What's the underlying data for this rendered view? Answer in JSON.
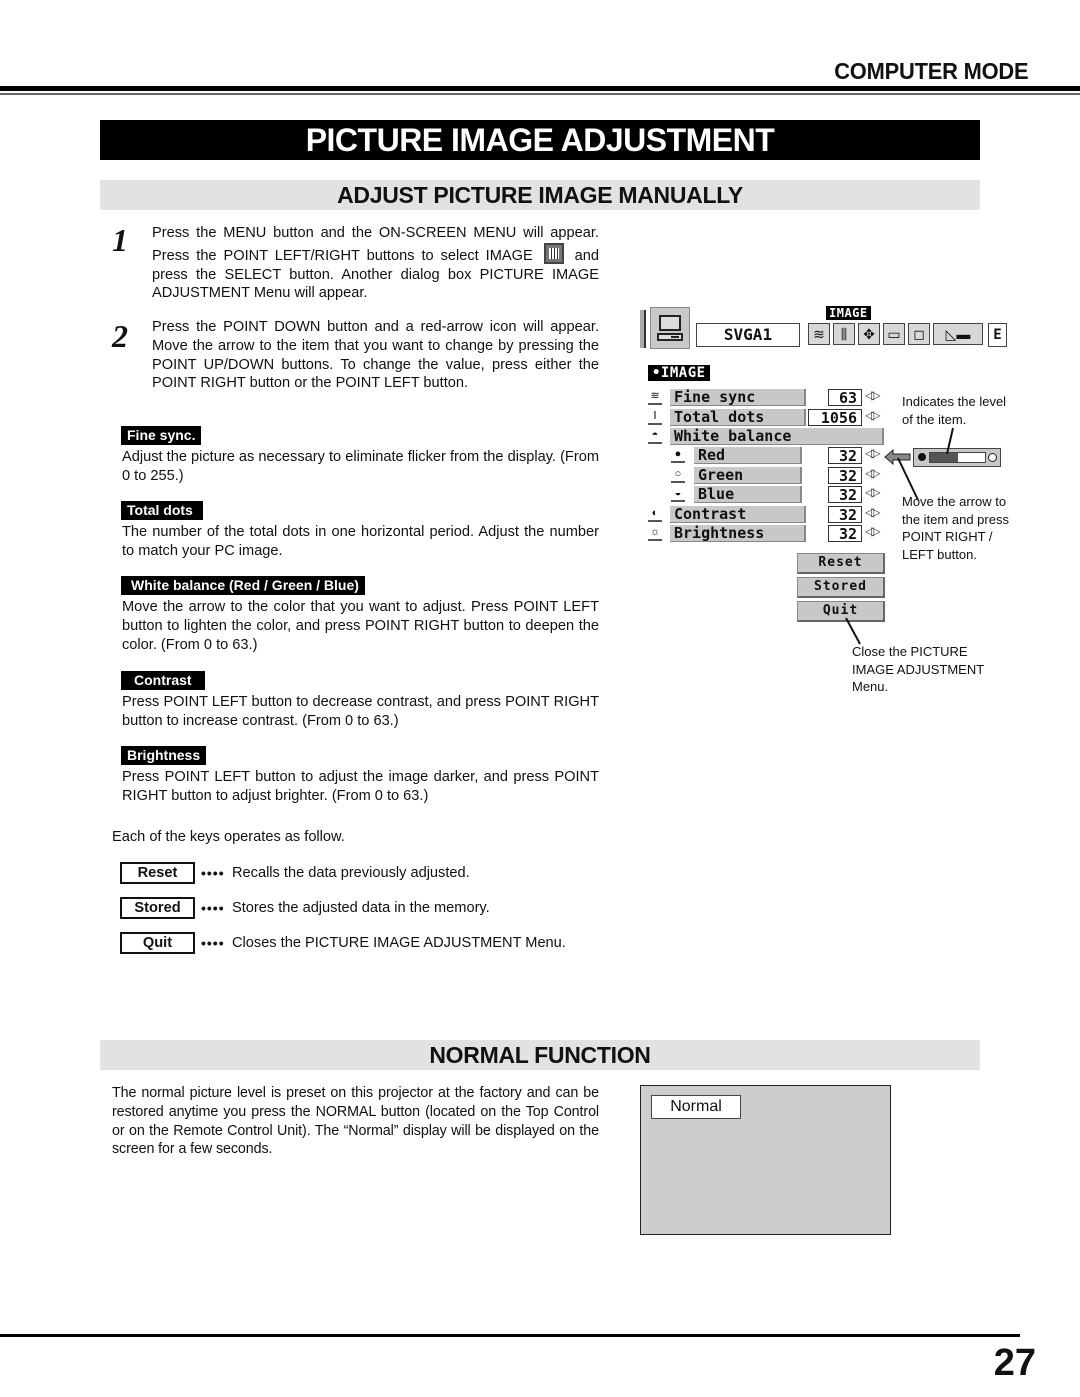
{
  "header": {
    "mode_label": "COMPUTER MODE",
    "page_title": "PICTURE IMAGE ADJUSTMENT"
  },
  "section_manual": {
    "title": "ADJUST PICTURE IMAGE MANUALLY",
    "steps": [
      {
        "number": "1",
        "text_before_icon": "Press the MENU button and the ON-SCREEN MENU will appear.  Press the POINT LEFT/RIGHT buttons to select IMAGE",
        "icon": "image-adjust-icon",
        "text_after_icon": "and press the SELECT button.  Another dialog box PICTURE IMAGE ADJUSTMENT Menu will appear."
      },
      {
        "number": "2",
        "text": "Press the POINT DOWN button and a red-arrow icon will appear.  Move the arrow to the item that you want to change by pressing the POINT UP/DOWN buttons.  To change the value, press either the POINT RIGHT button or the POINT LEFT button."
      }
    ],
    "items": [
      {
        "tag": "Fine sync.",
        "description": "Adjust the picture as necessary to eliminate flicker from the display. (From 0 to 255.)"
      },
      {
        "tag": "Total dots",
        "description": "The number of the total dots in one horizontal period.  Adjust the number to match your PC image."
      },
      {
        "tag": "White balance (Red / Green / Blue)",
        "description": "Move the arrow to the color that you want to adjust.  Press POINT LEFT button to lighten the color, and press POINT RIGHT button to deepen the color.  (From 0 to 63.)"
      },
      {
        "tag": "Contrast",
        "description": "Press POINT LEFT button to decrease contrast, and press POINT RIGHT button to increase contrast.  (From 0 to 63.)"
      },
      {
        "tag": "Brightness",
        "description": "Press POINT LEFT button to adjust the image darker, and press POINT RIGHT button to  adjust brighter.  (From 0 to 63.)"
      }
    ],
    "keys_intro": "Each of the keys operates as follow.",
    "keys": [
      {
        "label": "Reset",
        "dots": "••••",
        "description": "Recalls the data previously adjusted."
      },
      {
        "label": "Stored",
        "dots": "••••",
        "description": "Stores the adjusted data in the memory."
      },
      {
        "label": "Quit",
        "dots": "••••",
        "description": "Closes the PICTURE IMAGE ADJUSTMENT Menu."
      }
    ]
  },
  "osd": {
    "topbar": {
      "active_menu_label": "IMAGE",
      "source": "SVGA1",
      "right_truncated": "E",
      "icons": [
        "fine-sync-icon",
        "image-adjust-icon",
        "position-icon",
        "pc-adjust-icon",
        "screen-icon",
        "projector-icon"
      ]
    },
    "menu_title": "•IMAGE",
    "rows": [
      {
        "icon": "fine-sync-icon",
        "label": "Fine sync",
        "value": "63",
        "indent": false
      },
      {
        "icon": "total-dots-icon",
        "label": "Total dots",
        "value": "1056",
        "indent": false
      },
      {
        "icon": "white-balance-icon",
        "label": "White balance",
        "value": null,
        "indent": false
      },
      {
        "icon": "red-icon",
        "label": "Red",
        "value": "32",
        "indent": true
      },
      {
        "icon": "green-icon",
        "label": "Green",
        "value": "32",
        "indent": true
      },
      {
        "icon": "blue-icon",
        "label": "Blue",
        "value": "32",
        "indent": true
      },
      {
        "icon": "contrast-icon",
        "label": "Contrast",
        "value": "32",
        "indent": false
      },
      {
        "icon": "brightness-icon",
        "label": "Brightness",
        "value": "32",
        "indent": false
      }
    ],
    "arrows_glyph": "◁▷",
    "buttons": [
      "Reset",
      "Stored",
      "Quit"
    ],
    "level_bar_fraction": 0.5,
    "annotations": {
      "level": "Indicates the level of the item.",
      "arrow": "Move the arrow to the item and press POINT RIGHT / LEFT button.",
      "quit": "Close the PICTURE IMAGE ADJUSTMENT Menu."
    }
  },
  "section_normal": {
    "title": "NORMAL FUNCTION",
    "description": "The normal picture level is preset on this projector at the factory and can be restored anytime you press the NORMAL button (located on the Top Control or on the Remote Control Unit).  The “Normal” display will be displayed on the screen for a few seconds.",
    "screen_label": "Normal"
  },
  "footer": {
    "page_number": "27"
  }
}
